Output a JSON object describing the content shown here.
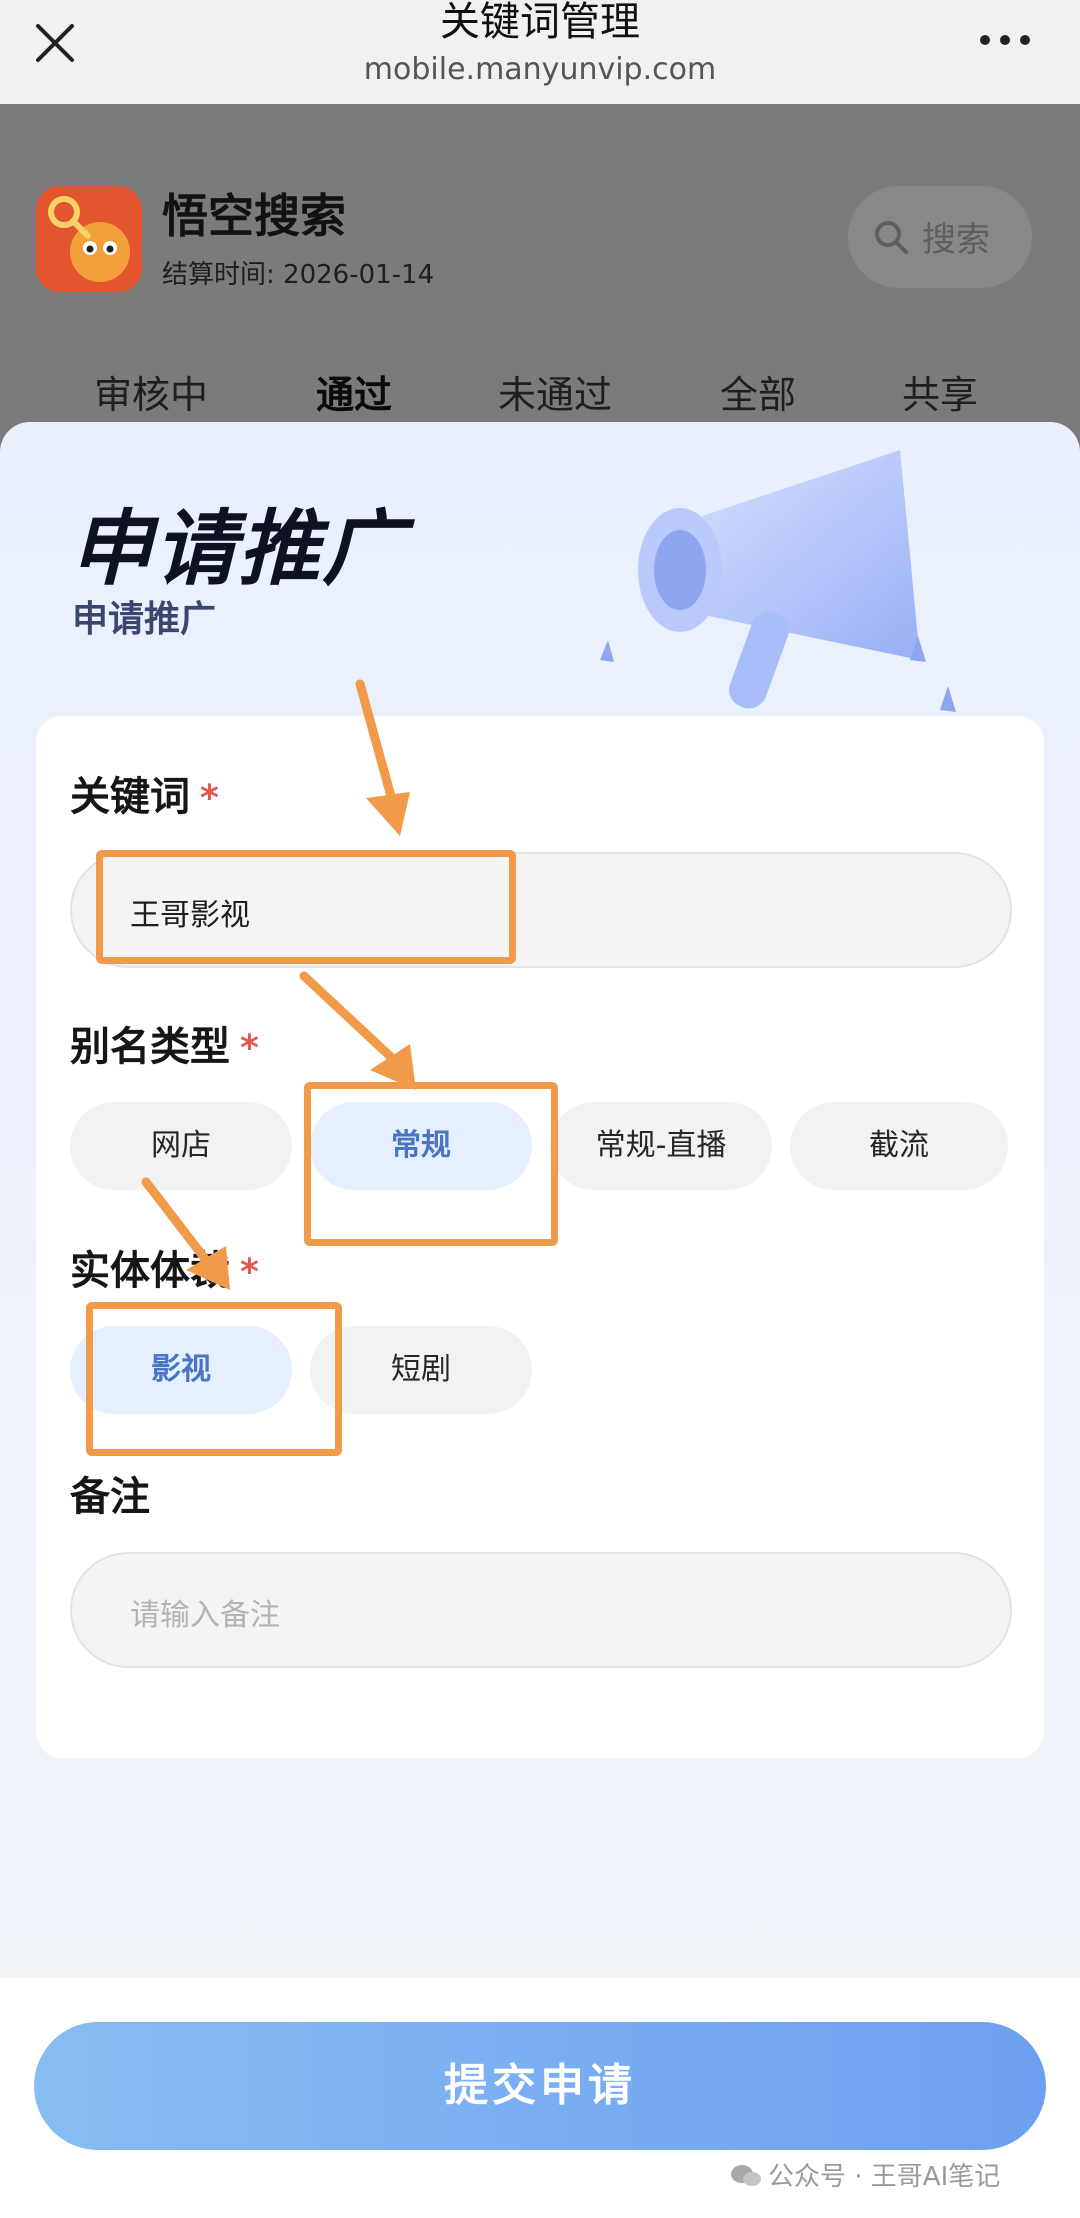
{
  "browser": {
    "title": "关键词管理",
    "url": "mobile.manyunvip.com",
    "close_icon": "close-icon",
    "more_icon": "more-icon"
  },
  "background_page": {
    "app_name": "悟空搜索",
    "settle_time": "结算时间: 2026-01-14",
    "search_label": "搜索",
    "tabs": [
      "审核中",
      "通过",
      "未通过",
      "全部",
      "共享"
    ],
    "active_tab": "通过"
  },
  "modal": {
    "title": "申请推广",
    "subtitle": "申请推广",
    "keyword": {
      "label": "关键词",
      "required_mark": "*",
      "value": "王哥影视"
    },
    "alias_type": {
      "label": "别名类型",
      "required_mark": "*",
      "options": [
        "网店",
        "常规",
        "常规-直播",
        "截流"
      ],
      "selected": "常规"
    },
    "entity": {
      "label": "实体体裁",
      "required_mark": "*",
      "options": [
        "影视",
        "短剧"
      ],
      "selected": "影视"
    },
    "note": {
      "label": "备注",
      "placeholder": "请输入备注"
    },
    "submit_label": "提交申请"
  },
  "watermark": "公众号 · 王哥AI笔记",
  "colors": {
    "accent": "#6d9ff0",
    "selected_chip_bg": "#e6efff",
    "annotation": "#f09a4a",
    "required": "#e0584e"
  }
}
